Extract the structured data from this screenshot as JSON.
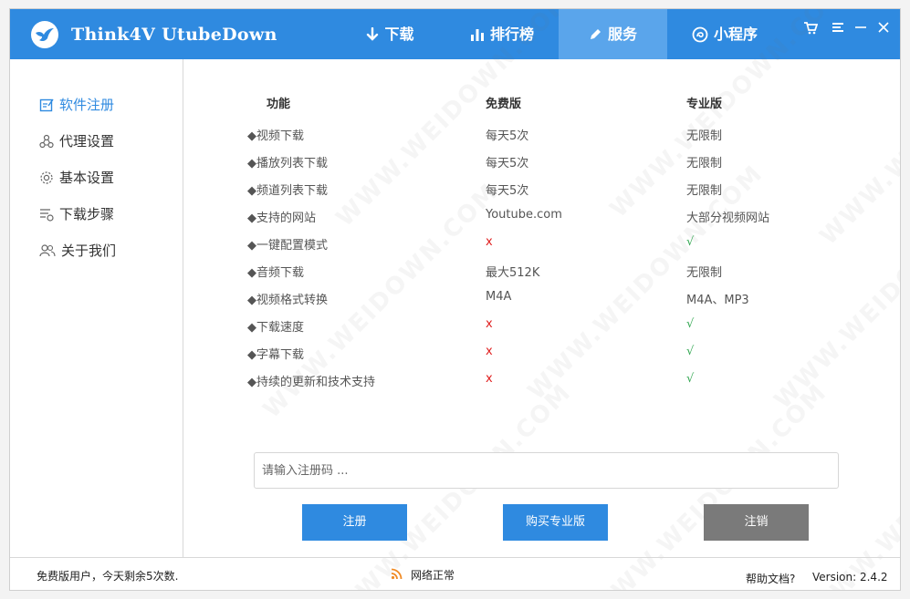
{
  "app": {
    "title": "Think4V UtubeDown",
    "brand_color": "#2f8ae0",
    "logo_icon": "bird-logo-icon"
  },
  "nav": {
    "tabs": [
      {
        "label": "下载",
        "icon": "arrow-down-icon",
        "active": false
      },
      {
        "label": "排行榜",
        "icon": "bar-chart-icon",
        "active": false
      },
      {
        "label": "服务",
        "icon": "pencil-icon",
        "active": true
      },
      {
        "label": "小程序",
        "icon": "mini-program-icon",
        "active": false
      }
    ],
    "window_controls": [
      "cart-icon",
      "menu-icon",
      "minimize-icon",
      "close-icon"
    ]
  },
  "sidebar": {
    "items": [
      {
        "label": "软件注册",
        "icon": "register-icon",
        "active": true
      },
      {
        "label": "代理设置",
        "icon": "proxy-icon",
        "active": false
      },
      {
        "label": "基本设置",
        "icon": "gear-icon",
        "active": false
      },
      {
        "label": "下载步骤",
        "icon": "steps-icon",
        "active": false
      },
      {
        "label": "关于我们",
        "icon": "users-icon",
        "active": false
      }
    ]
  },
  "comparison": {
    "headers": {
      "feature": "功能",
      "free": "免费版",
      "pro": "专业版"
    },
    "rows": [
      {
        "feature": "◆视频下载",
        "free": "每天5次",
        "pro": "无限制"
      },
      {
        "feature": "◆播放列表下载",
        "free": "每天5次",
        "pro": "无限制"
      },
      {
        "feature": "◆频道列表下载",
        "free": "每天5次",
        "pro": "无限制"
      },
      {
        "feature": "◆支持的网站",
        "free": "Youtube.com",
        "pro": "大部分视频网站"
      },
      {
        "feature": "◆一键配置模式",
        "free": "x",
        "pro": "√"
      },
      {
        "feature": "◆音频下载",
        "free": "最大512K",
        "pro": "无限制"
      },
      {
        "feature": "◆视频格式转换",
        "free": "M4A",
        "pro": "M4A、MP3"
      },
      {
        "feature": "◆下载速度",
        "free": "x",
        "pro": "√"
      },
      {
        "feature": "◆字幕下载",
        "free": "x",
        "pro": "√"
      },
      {
        "feature": "◆持续的更新和技术支持",
        "free": "x",
        "pro": "√"
      }
    ]
  },
  "registration": {
    "placeholder": "请输入注册码 ...",
    "value": "",
    "register_label": "注册",
    "buy_label": "购买专业版",
    "unregister_label": "注销"
  },
  "watermark_text": "WWW.WEIDOWN.COM",
  "status": {
    "user_text": "免费版用户，今天剩余5次数.",
    "network_text": "网络正常",
    "help_text": "帮助文档?",
    "version_text": "Version: 2.4.2"
  }
}
